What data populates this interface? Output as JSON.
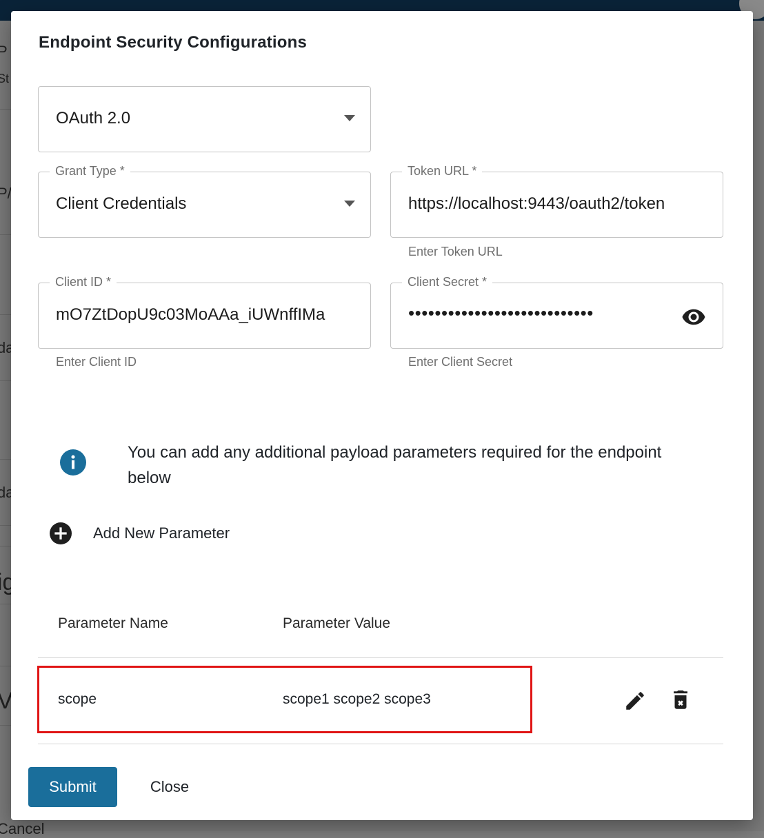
{
  "dialog": {
    "title": "Endpoint Security Configurations",
    "auth_type": "OAuth 2.0",
    "grant_type": {
      "label": "Grant Type *",
      "value": "Client Credentials"
    },
    "token_url": {
      "label": "Token URL *",
      "value": "https://localhost:9443/oauth2/token",
      "helper": "Enter Token URL"
    },
    "client_id": {
      "label": "Client ID *",
      "value": "mO7ZtDopU9c03MoAAa_iUWnffIMa",
      "helper": "Enter Client ID"
    },
    "client_secret": {
      "label": "Client Secret *",
      "value": "••••••••••••••••••••••••••••",
      "helper": "Enter Client Secret"
    },
    "info_text": "You can add any additional payload parameters required for the endpoint below",
    "add_parameter_label": "Add New Parameter",
    "table": {
      "headers": [
        "Parameter Name",
        "Parameter Value"
      ],
      "rows": [
        {
          "name": "scope",
          "value": "scope1 scope2 scope3"
        }
      ]
    },
    "submit_label": "Submit",
    "close_label": "Close"
  },
  "background": {
    "fragments": [
      "P",
      "St",
      "P/",
      "da",
      "da",
      "ig",
      "V",
      "Cancel"
    ]
  },
  "icons": {
    "dropdown": "chevron-down-icon",
    "visibility": "eye-icon",
    "info": "info-icon",
    "add": "plus-circle-icon",
    "edit": "pencil-icon",
    "delete": "trash-icon"
  },
  "colors": {
    "primary": "#1a6e9b",
    "highlight": "#e01515",
    "topbar": "#0a2338"
  }
}
